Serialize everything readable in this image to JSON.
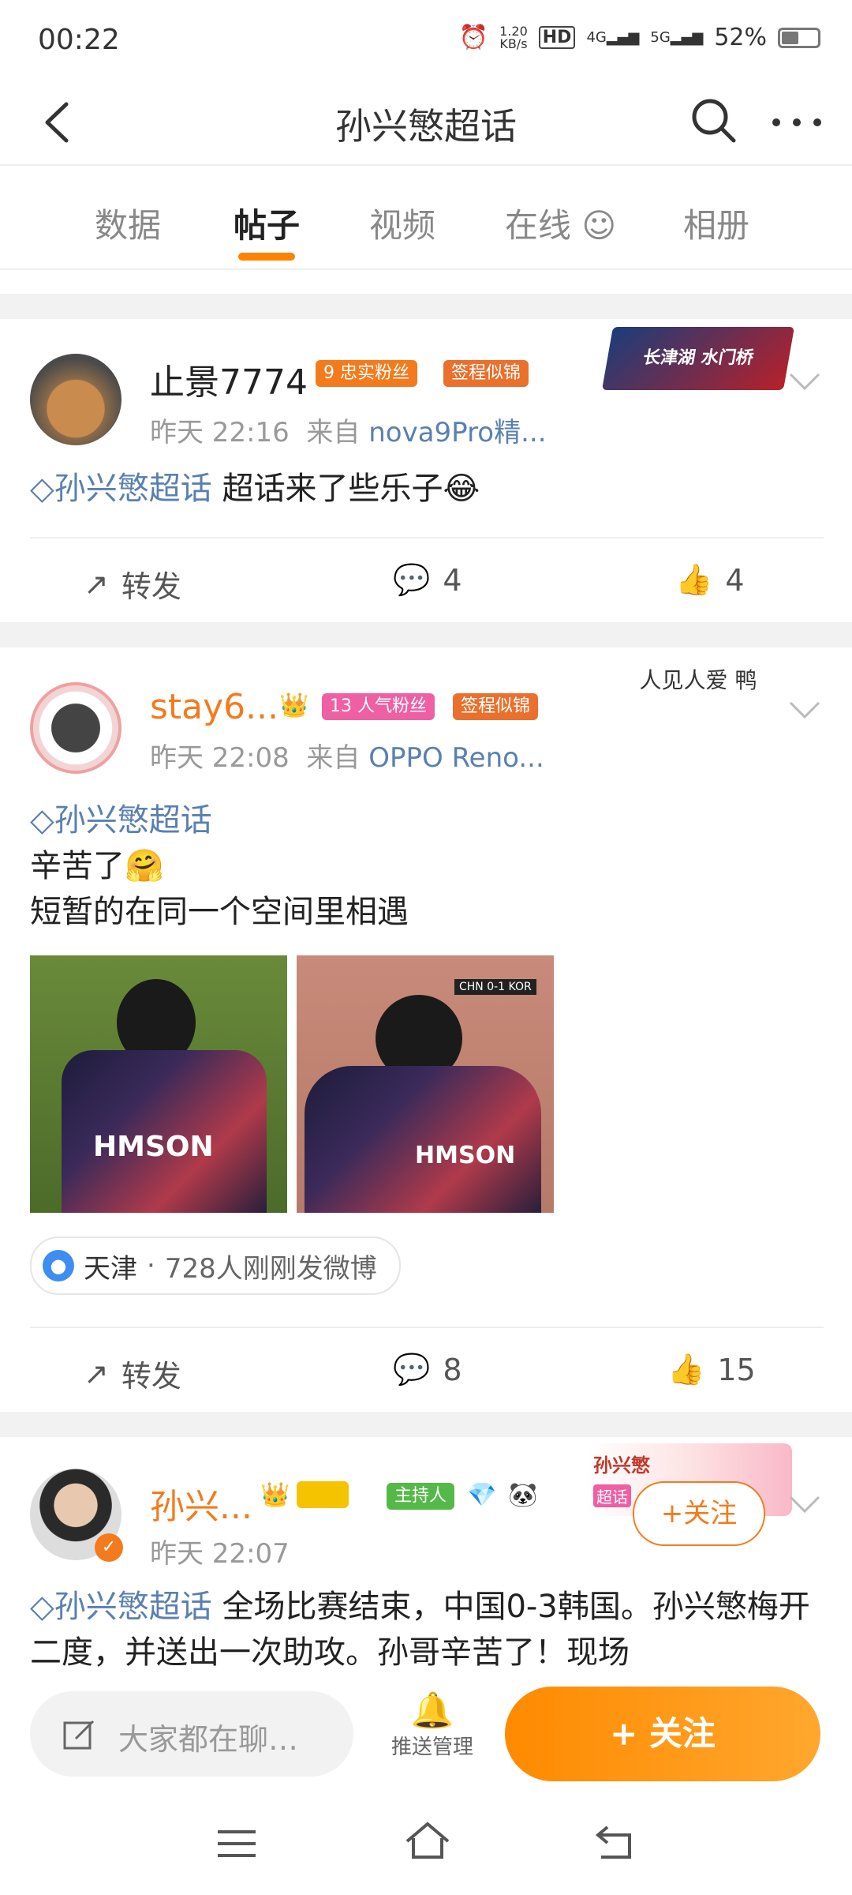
{
  "status_bar": {
    "time": "00:22",
    "speed_top": "1.20",
    "speed_bottom": "KB/s",
    "hd": "HD",
    "net1": "4G",
    "net2": "5G",
    "battery": "52%"
  },
  "nav": {
    "title": "孙兴慜超话"
  },
  "tabs": [
    {
      "label": "数据"
    },
    {
      "label": "帖子",
      "active": true
    },
    {
      "label": "视频"
    },
    {
      "label": "在线"
    },
    {
      "label": "相册"
    }
  ],
  "posts": [
    {
      "username": "止景7774",
      "fan_level": "9",
      "badge1": "忠实粉丝",
      "badge2": "签程似锦",
      "time": "昨天 22:16",
      "from_label": "来自",
      "source": "nova9Pro精...",
      "topic": "孙兴慜超话",
      "text": "超话来了些乐子",
      "repost": "转发",
      "comments": "4",
      "likes": "4",
      "deco_text": "长津湖 水门桥"
    },
    {
      "username": "stay6...",
      "fan_level": "13",
      "badge1": "人气粉丝",
      "badge2": "签程似锦",
      "time": "昨天 22:08",
      "from_label": "来自",
      "source": "OPPO Reno...",
      "topic": "孙兴慜超话",
      "line1": "辛苦了",
      "line2": "短暂的在同一个空间里相遇",
      "jersey1": "HMSON",
      "jersey2": "HMSON",
      "score_bar": "CHN 0-1 KOR",
      "location": "天津",
      "location_dot": "·",
      "location_count": "728人刚刚发微博",
      "repost": "转发",
      "comments": "8",
      "likes": "15",
      "deco_text": "人见人爱 鸭"
    },
    {
      "username": "孙兴...",
      "badge1": "主持人",
      "time": "昨天 22:07",
      "topic": "孙兴慜超话",
      "text": "全场比赛结束，中国0-3韩国。孙兴慜梅开二度，并送出一次助攻。孙哥辛苦了！现场",
      "follow": "+关注",
      "deco_text": "孙兴慜",
      "deco_sub": "超话"
    }
  ],
  "bottom": {
    "placeholder": "大家都在聊…",
    "push_label": "推送管理",
    "follow_label": "+ 关注"
  },
  "colors": {
    "accent": "#ff8200",
    "link": "#5a80b0",
    "badge_orange": "#f37b1d",
    "badge_pink": "#ee5fa4"
  }
}
